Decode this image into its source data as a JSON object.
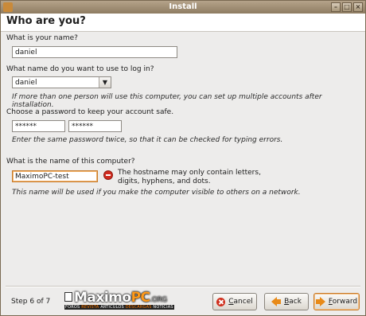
{
  "window": {
    "title": "Install"
  },
  "header": {
    "title": "Who are you?"
  },
  "name": {
    "label": "What is your name?",
    "value": "daniel"
  },
  "login": {
    "label": "What name do you want to use to log in?",
    "value": "daniel",
    "hint": "If more than one person will use this computer, you can set up multiple accounts after installation."
  },
  "password": {
    "label": "Choose a password to keep your account safe.",
    "value1": "******",
    "value2": "******",
    "hint": "Enter the same password twice, so that it can be checked for typing errors."
  },
  "hostname": {
    "label": "What is the name of this computer?",
    "value": "MaximoPC-test",
    "warning": "The hostname may only contain letters, digits, hyphens, and dots.",
    "hint": "This name will be used if you make the computer visible to others on a network."
  },
  "footer": {
    "step": "Step 6 of 7",
    "cancel_prefix": "",
    "cancel_mnemonic": "C",
    "cancel_rest": "ancel",
    "back_prefix": "",
    "back_mnemonic": "B",
    "back_rest": "ack",
    "forward_prefix": "",
    "forward_mnemonic": "F",
    "forward_rest": "orward"
  },
  "watermark": {
    "main": "Maximo",
    "pc": "PC",
    "org": ".ORG",
    "sub_a": "FOROS",
    "sub_b": "REVISTA",
    "sub_c": "ARTICULOS",
    "sub_d": "DESCARGAS",
    "sub_e": "NOTICIAS"
  },
  "colors": {
    "accent": "#e88a18",
    "error": "#d12b1f",
    "titlebar": "#9e8c70"
  }
}
